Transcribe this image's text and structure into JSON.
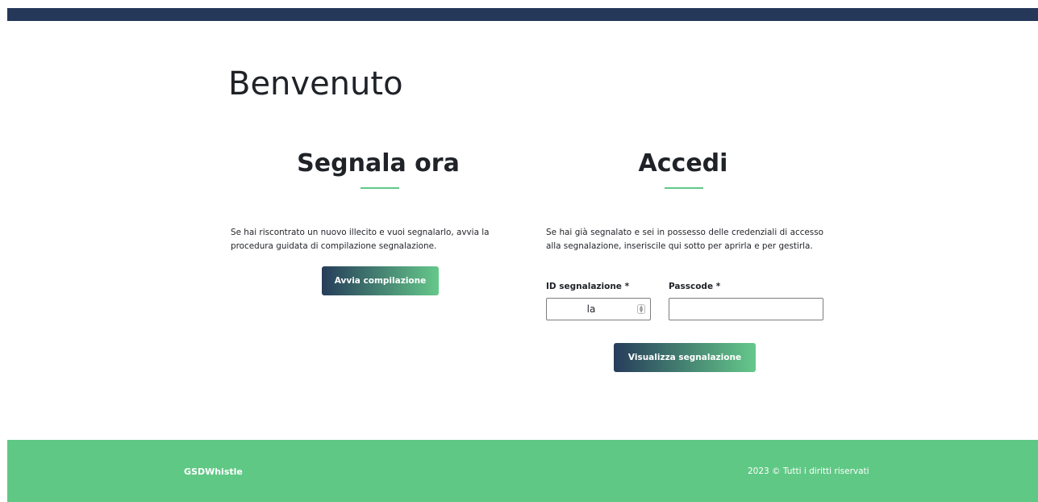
{
  "page": {
    "welcome_title": "Benvenuto"
  },
  "report_section": {
    "title": "Segnala ora",
    "description": "Se hai riscontrato un nuovo illecito e vuoi segnalarlo, avvia la procedura guidata di compilazione segnalazione.",
    "button_label": "Avvia compilazione"
  },
  "login_section": {
    "title": "Accedi",
    "description": "Se hai già segnalato e sei in possesso delle credenziali di accesso alla segnalazione, inseriscile qui sotto per aprirla e per gestirla.",
    "id_label": "ID segnalazione *",
    "id_value": "la",
    "passcode_label": "Passcode *",
    "passcode_value": "",
    "button_label": "Visualizza segnalazione"
  },
  "footer": {
    "brand": "GSDWhistle",
    "copyright": "2023 © Tutti i diritti riservati"
  },
  "colors": {
    "top_bar": "#26385a",
    "accent_green": "#61c986",
    "button_gradient_start": "#263d5a",
    "button_gradient_end": "#65c88a",
    "footer": "#60c885"
  },
  "icons": {
    "stepper": "number-stepper-icon"
  }
}
